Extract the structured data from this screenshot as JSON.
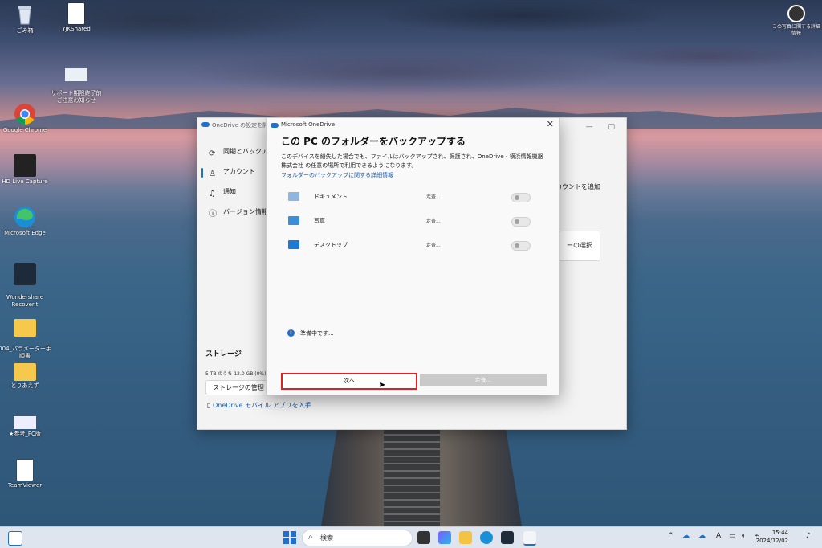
{
  "desktop": {
    "icons": [
      {
        "label": "ごみ箱"
      },
      {
        "label": "YJKShared"
      },
      {
        "label": "サポート期限終了前\nご注意お知らせ"
      },
      {
        "label": "Google Chrome"
      },
      {
        "label": "HD Live Capture"
      },
      {
        "label": "Microsoft Edge"
      },
      {
        "label": "Wondershare\nRecoverit"
      },
      {
        "label": "004_パラメーター手\n順書"
      },
      {
        "label": "とりあえず"
      },
      {
        "label": "★参考_PC版"
      },
      {
        "label": "TeamViewer"
      }
    ],
    "widget_label": "この写真に関する詳細情報"
  },
  "settings_window": {
    "title": "OneDrive の設定を開",
    "nav": [
      {
        "label": "同期とバックアップ",
        "icon": "sync-icon"
      },
      {
        "label": "アカウント",
        "icon": "person-icon"
      },
      {
        "label": "通知",
        "icon": "bell-icon"
      },
      {
        "label": "バージョン情報",
        "icon": "info-icon"
      }
    ],
    "add_account_label": "カウントを追加",
    "choose_folder_label": "ーの選択",
    "storage_heading": "ストレージ",
    "storage_usage": "5 TB のうち 12.0 GB (0%)",
    "manage_storage_label": "ストレージの管理",
    "mobile_app_link": "OneDrive モバイル アプリを入手"
  },
  "dialog": {
    "app_title": "Microsoft OneDrive",
    "heading": "この PC のフォルダーをバックアップする",
    "description": "このデバイスを紛失した場合でも、ファイルはバックアップされ、保護され、OneDrive - 横浜情報機器株式会社 の任意の場所で利用できるようになります。",
    "details_link": "フォルダーのバックアップに関する詳細情報",
    "folders": [
      {
        "name": "ドキュメント",
        "status": "走査...",
        "on": false
      },
      {
        "name": "写真",
        "status": "走査...",
        "on": false
      },
      {
        "name": "デスクトップ",
        "status": "走査...",
        "on": false
      }
    ],
    "status_text": "準備中です...",
    "next_button": "次へ",
    "skip_button": "走査..."
  },
  "taskbar": {
    "search_placeholder": "検索",
    "time": "15:44",
    "date": "2024/12/02",
    "ime_label": "A"
  }
}
